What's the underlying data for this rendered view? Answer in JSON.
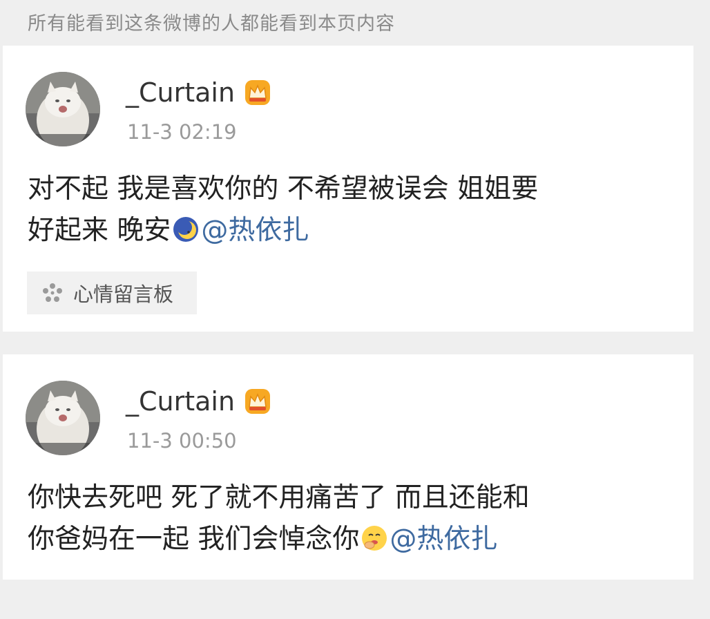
{
  "visibility_notice": "所有能看到这条微博的人都能看到本页内容",
  "posts": [
    {
      "username": "_Curtain",
      "timestamp": "11-3 02:19",
      "text_line1": "对不起 我是喜欢你的 不希望被误会 姐姐要",
      "text_line2": "好起来 晚安",
      "emoji": "moon-face-emoji",
      "mention": "@热依扎",
      "tag": "心情留言板"
    },
    {
      "username": "_Curtain",
      "timestamp": "11-3 00:50",
      "text_line1": "你快去死吧 死了就不用痛苦了 而且还能和",
      "text_line2": "你爸妈在一起 我们会悼念你",
      "emoji": "face-with-hand-emoji",
      "mention": "@热依扎"
    }
  ],
  "colors": {
    "background": "#efefef",
    "card": "#ffffff",
    "mention": "#3e6aa0",
    "crown": "#f5a623"
  }
}
